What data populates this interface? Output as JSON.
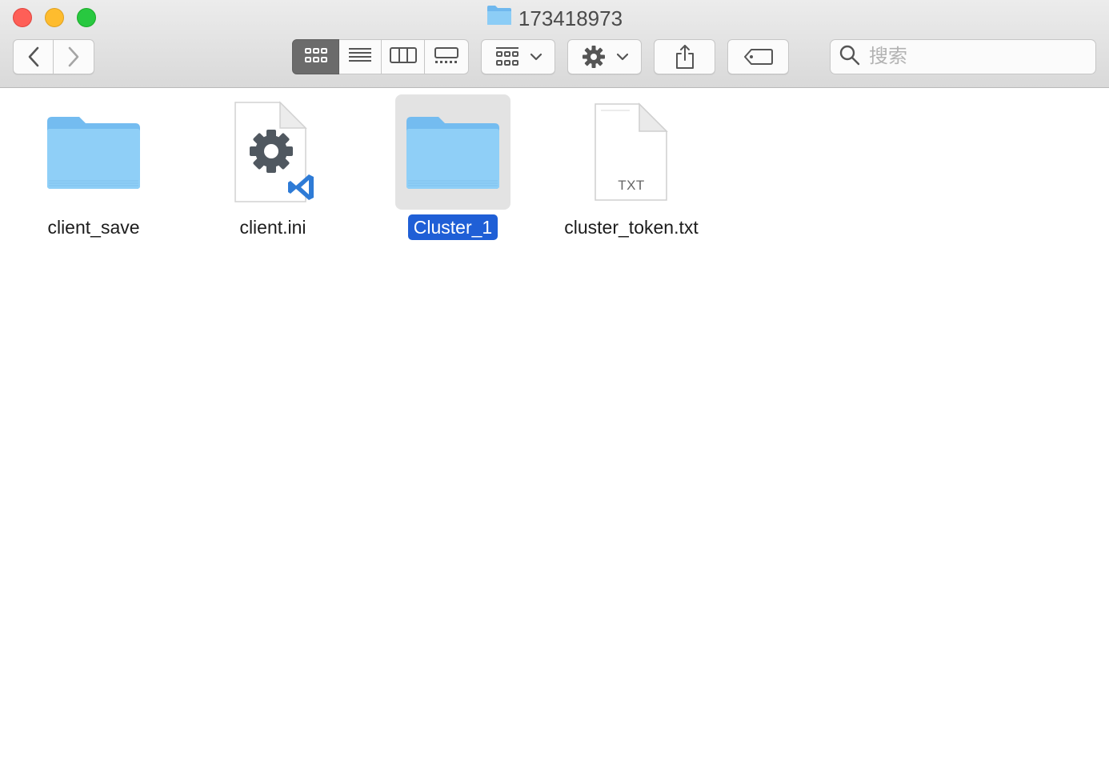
{
  "window": {
    "title": "173418973",
    "title_icon": "folder-icon"
  },
  "toolbar": {
    "back_icon": "chevron-left-icon",
    "forward_icon": "chevron-right-icon",
    "view_modes": [
      "icon-view-icon",
      "list-view-icon",
      "column-view-icon",
      "gallery-view-icon"
    ],
    "active_view": "icon-view-icon",
    "group_icon": "group-by-icon",
    "action_icon": "gear-icon",
    "share_icon": "share-icon",
    "tag_icon": "tag-icon",
    "search": {
      "placeholder": "搜索",
      "value": ""
    }
  },
  "files": [
    {
      "name": "client_save",
      "kind": "folder",
      "selected": false
    },
    {
      "name": "client.ini",
      "kind": "config-file",
      "selected": false
    },
    {
      "name": "Cluster_1",
      "kind": "folder",
      "selected": true
    },
    {
      "name": "cluster_token.txt",
      "kind": "text-file",
      "badge": "TXT",
      "selected": false
    }
  ],
  "colors": {
    "selection": "#1f5fd6",
    "folder": "#7fc4f4",
    "close": "#fe5f57",
    "minimize": "#febc2e",
    "maximize": "#28c840"
  }
}
